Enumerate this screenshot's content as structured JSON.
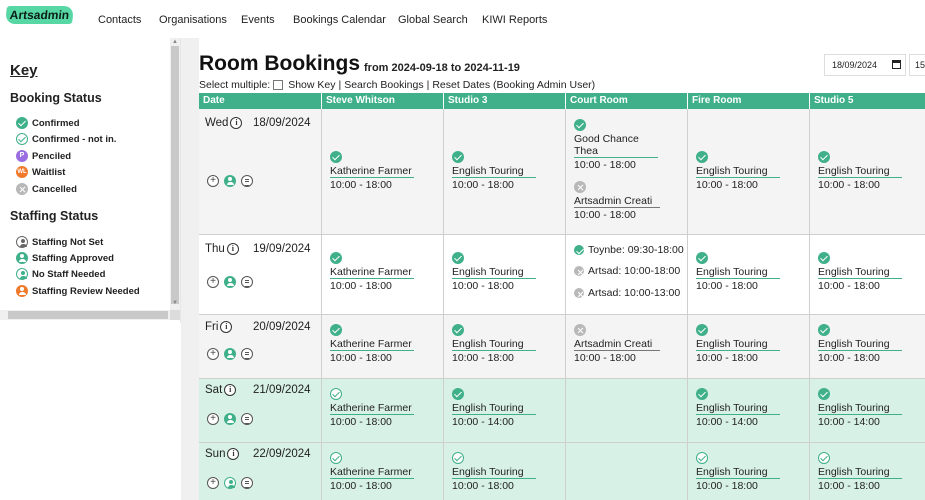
{
  "app": {
    "logo": "Artsadmin"
  },
  "nav": [
    "Contacts",
    "Organisations",
    "Events",
    "Bookings Calendar",
    "Global Search",
    "KIWI Reports"
  ],
  "sidebar": {
    "key_title": "Key",
    "booking_status_title": "Booking Status",
    "booking_status": [
      {
        "label": "Confirmed",
        "icon": "confirmed-icon"
      },
      {
        "label": "Confirmed - not in.",
        "icon": "confirmed-not-in-icon"
      },
      {
        "label": "Penciled",
        "icon": "pencil-icon",
        "glyph": "P"
      },
      {
        "label": "Waitlist",
        "icon": "waitlist-icon",
        "glyph": "WL"
      },
      {
        "label": "Cancelled",
        "icon": "cancelled-icon"
      }
    ],
    "staffing_status_title": "Staffing Status",
    "staffing_status": [
      {
        "label": "Staffing Not Set",
        "icon": "staff-not-set-icon"
      },
      {
        "label": "Staffing Approved",
        "icon": "staff-approved-icon"
      },
      {
        "label": "No Staff Needed",
        "icon": "no-staff-needed-icon"
      },
      {
        "label": "Staffing Review Needed",
        "icon": "staff-review-icon"
      }
    ]
  },
  "main": {
    "title": "Room Bookings",
    "subtitle": "from 2024-09-18 to 2024-11-19",
    "date_from": "18/09/2024",
    "date_to": "15/",
    "toolbar": {
      "select_multiple": "Select multiple:",
      "show_key": "Show Key",
      "sep": "|",
      "search": "Search Bookings",
      "reset": "Reset Dates (Booking Admin User)"
    },
    "columns": [
      "Date",
      "Steve Whitson",
      "Studio 3",
      "Court Room",
      "Fire Room",
      "Studio 5"
    ],
    "rows": [
      {
        "day": "Wed",
        "date": "18/09/2024",
        "cells": {
          "steve": {
            "name": "Katherine Farmer",
            "time": "10:00 - 18:00"
          },
          "studio3": {
            "name": "English Touring",
            "time": "10:00 - 18:00"
          },
          "court": [
            {
              "name_l1": "Good Chance",
              "name_l2": "Thea",
              "time": "10:00 - 18:00"
            },
            {
              "name": "Artsadmin Creati",
              "time": "10:00 - 18:00"
            }
          ],
          "fire": {
            "name": "English Touring",
            "time": "10:00 - 18:00"
          },
          "studio5": {
            "name": "English Touring",
            "time": "10:00 - 18:00"
          }
        }
      },
      {
        "day": "Thu",
        "date": "19/09/2024",
        "cells": {
          "steve": {
            "name": "Katherine Farmer",
            "time": "10:00 - 18:00"
          },
          "studio3": {
            "name": "English Touring",
            "time": "10:00 - 18:00"
          },
          "court": [
            {
              "text": "Toynbe: 09:30-18:00"
            },
            {
              "text": "Artsad: 10:00-18:00"
            },
            {
              "text": "Artsad: 10:00-13:00"
            }
          ],
          "fire": {
            "name": "English Touring",
            "time": "10:00 - 18:00"
          },
          "studio5": {
            "name": "English Touring",
            "time": "10:00 - 18:00"
          }
        }
      },
      {
        "day": "Fri",
        "date": "20/09/2024",
        "cells": {
          "steve": {
            "name": "Katherine Farmer",
            "time": "10:00 - 18:00"
          },
          "studio3": {
            "name": "English Touring",
            "time": "10:00 - 18:00"
          },
          "court": {
            "name": "Artsadmin Creati",
            "time": "10:00 - 18:00"
          },
          "fire": {
            "name": "English Touring",
            "time": "10:00 - 18:00"
          },
          "studio5": {
            "name": "English Touring",
            "time": "10:00 - 18:00"
          }
        }
      },
      {
        "day": "Sat",
        "date": "21/09/2024",
        "cells": {
          "steve": {
            "name": "Katherine Farmer",
            "time": "10:00 - 18:00"
          },
          "studio3": {
            "name": "English Touring",
            "time": "10:00 - 14:00"
          },
          "fire": {
            "name": "English Touring",
            "time": "10:00 - 14:00"
          },
          "studio5": {
            "name": "English Touring",
            "time": "10:00 - 14:00"
          }
        }
      },
      {
        "day": "Sun",
        "date": "22/09/2024",
        "cells": {
          "steve": {
            "name": "Katherine Farmer",
            "time": "10:00 - 18:00"
          },
          "studio3": {
            "name": "English Touring",
            "time": "10:00 - 18:00"
          },
          "fire": {
            "name": "English Touring",
            "time": "10:00 - 18:00"
          },
          "studio5": {
            "name": "English Touring",
            "time": "10:00 - 18:00"
          }
        }
      }
    ]
  },
  "colors": {
    "accent": "#3fb08a",
    "logo_bg": "#57d7a4",
    "weekend_row": "#d8f1e7",
    "pencil": "#9a6de0",
    "waitlist": "#f07a2c"
  }
}
